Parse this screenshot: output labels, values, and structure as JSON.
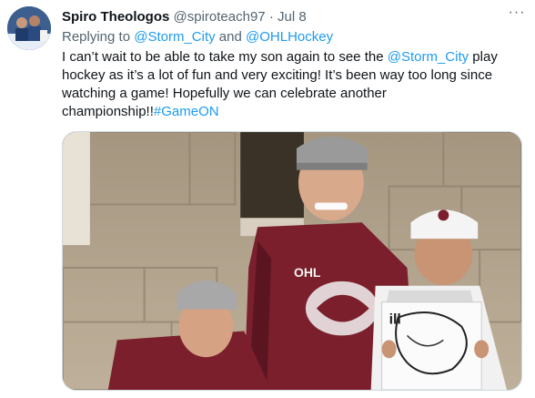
{
  "tweet": {
    "author_name": "Spiro Theologos",
    "author_handle": "@spiroteach97",
    "separator": "·",
    "date": "Jul 8",
    "more_icon": "more-icon",
    "reply": {
      "prefix": "Replying to ",
      "mention1": "@Storm_City",
      "joiner": " and ",
      "mention2": "@OHLHockey"
    },
    "text": {
      "part1": "I can’t wait to be able to take my son again to see the ",
      "mention": "@Storm_City",
      "part2": " play hockey as it’s a lot of fun and very exciting! It’s been way too long since watching a game! Hopefully we can celebrate another championship!!",
      "hashtag": "#GameON"
    },
    "photo": {
      "jersey_text": "OHL",
      "sign_text": "ill"
    }
  },
  "colors": {
    "link": "#1d9bf0",
    "secondary": "#536471",
    "jersey": "#7a1f2b"
  }
}
